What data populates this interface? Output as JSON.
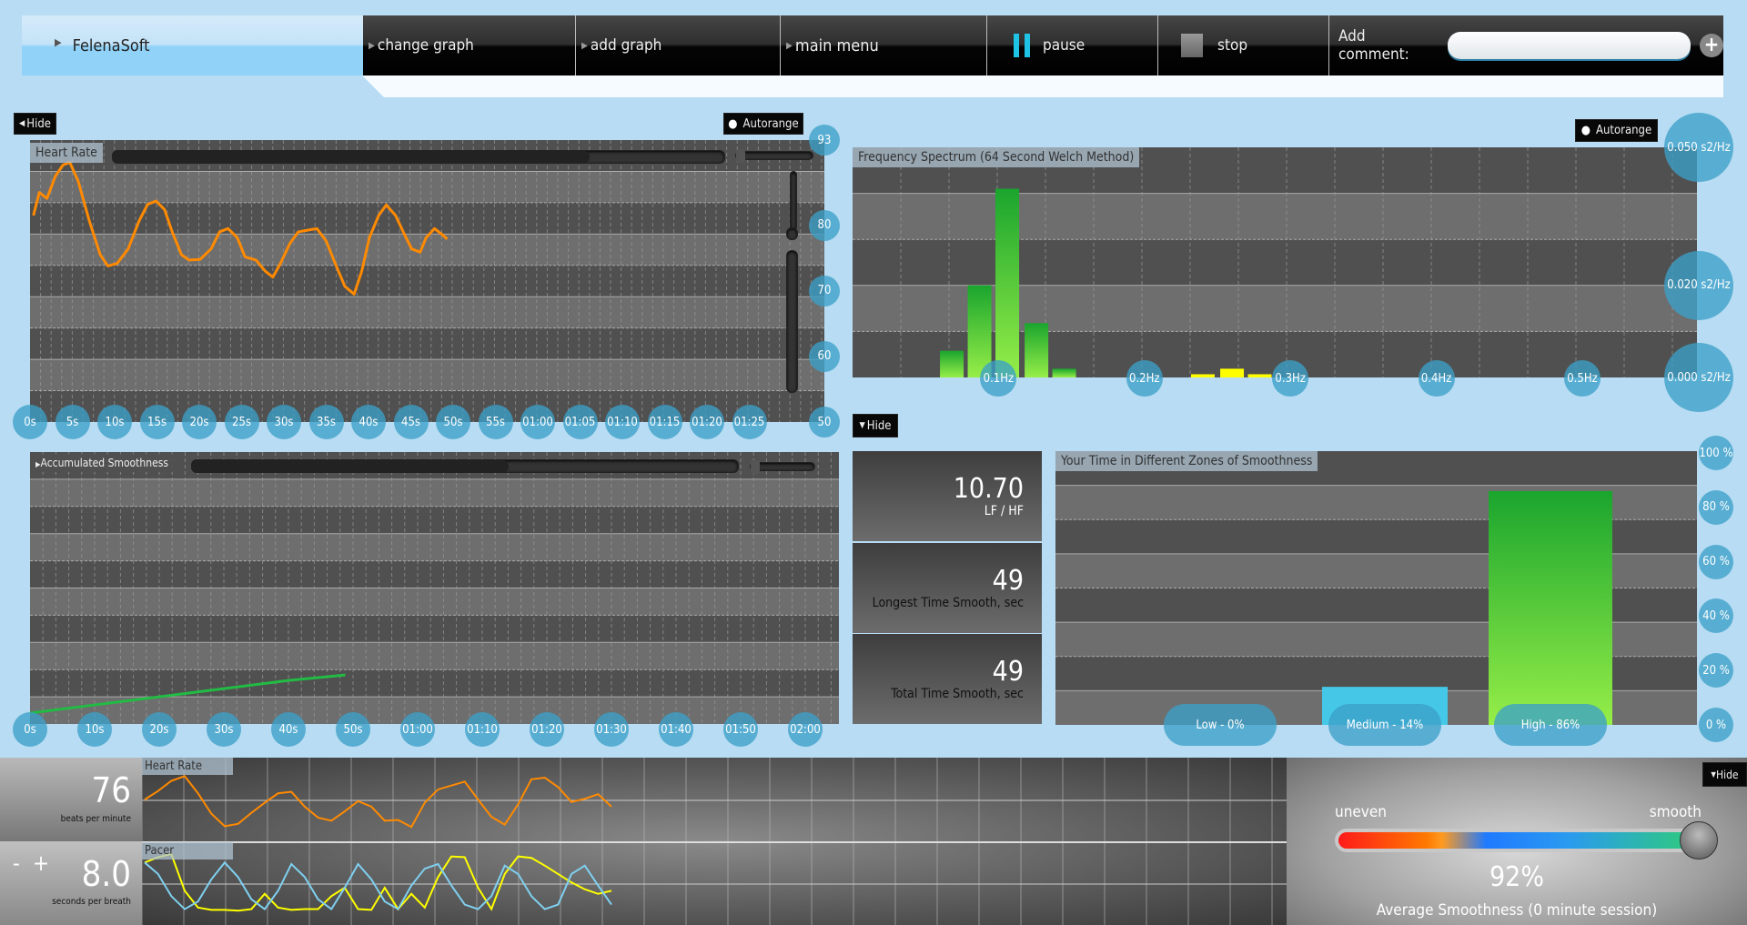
{
  "header": {
    "app_name": "FelenaSoft",
    "buttons": [
      {
        "label": "change graph"
      },
      {
        "label": "add graph"
      },
      {
        "label": "main menu"
      },
      {
        "label": "pause",
        "icon": "pause-icon"
      },
      {
        "label": "stop",
        "icon": "stop-icon"
      }
    ],
    "comment_label": "Add comment:",
    "comment_value": "",
    "add_icon": "plus-icon"
  },
  "controls": {
    "hide": "Hide",
    "autorange": "Autorange"
  },
  "colors": {
    "accent": "#3ca0c8",
    "heart_rate": "#ff8a00",
    "green": "#22aa33",
    "yellow": "#ffff00",
    "medium": "#45c8e8",
    "pacer_blue": "#7fd0f0"
  },
  "chart_data": [
    {
      "type": "line",
      "title": "Heart Rate",
      "ylim": [
        50,
        93
      ],
      "yticks": [
        "93",
        "80",
        "70",
        "60",
        "50"
      ],
      "xlim": [
        0,
        88
      ],
      "xticks": [
        "0s",
        "5s",
        "10s",
        "15s",
        "20s",
        "25s",
        "30s",
        "35s",
        "40s",
        "45s",
        "50s",
        "55s",
        "01:00",
        "01:05",
        "01:10",
        "01:15",
        "01:20",
        "01:25"
      ],
      "series": [
        {
          "color": "#ff8a00",
          "points": [
            [
              0.4,
              81.5
            ],
            [
              1.1,
              85
            ],
            [
              2,
              84.1
            ],
            [
              3,
              87.5
            ],
            [
              3.9,
              89.2
            ],
            [
              4.7,
              89.6
            ],
            [
              5.7,
              86.7
            ],
            [
              7,
              80.7
            ],
            [
              8.3,
              75.5
            ],
            [
              9.2,
              73.8
            ],
            [
              10.3,
              74.2
            ],
            [
              11.6,
              76.4
            ],
            [
              12.9,
              80.7
            ],
            [
              13.9,
              83.2
            ],
            [
              14.9,
              83.7
            ],
            [
              15.9,
              82.4
            ],
            [
              16.8,
              79
            ],
            [
              17.9,
              75.5
            ],
            [
              18.8,
              74.7
            ],
            [
              20.1,
              74.8
            ],
            [
              21.4,
              76.4
            ],
            [
              22.4,
              79
            ],
            [
              23.4,
              79.5
            ],
            [
              24.5,
              78.1
            ],
            [
              25.4,
              75.2
            ],
            [
              26.7,
              74.7
            ],
            [
              27.8,
              73
            ],
            [
              28.7,
              72.1
            ],
            [
              29.6,
              74.2
            ],
            [
              30.7,
              77.2
            ],
            [
              31.7,
              79
            ],
            [
              33,
              79.3
            ],
            [
              33.9,
              79.5
            ],
            [
              35,
              77.6
            ],
            [
              35.9,
              74.7
            ],
            [
              37.2,
              70.7
            ],
            [
              38.3,
              69.5
            ],
            [
              39.2,
              73
            ],
            [
              40.1,
              78.1
            ],
            [
              41.2,
              81.5
            ],
            [
              42.1,
              83.1
            ],
            [
              43.2,
              81.5
            ],
            [
              44.1,
              79
            ],
            [
              45.1,
              76.4
            ],
            [
              46.1,
              75.9
            ],
            [
              46.8,
              78.1
            ],
            [
              47.8,
              79.5
            ],
            [
              48.7,
              78.6
            ],
            [
              49.3,
              77.9
            ]
          ]
        }
      ]
    },
    {
      "type": "bar",
      "title": "Frequency Spectrum (64 Second Welch Method)",
      "ylim": [
        0,
        0.05
      ],
      "yticks": [
        "0.050 s2/Hz",
        "0.020 s2/Hz",
        "0.000 s2/Hz"
      ],
      "xlim": [
        0,
        0.58
      ],
      "xticks": [
        "0.1Hz",
        "0.2Hz",
        "0.3Hz",
        "0.4Hz",
        "0.5Hz"
      ],
      "bars": [
        {
          "x": 0.068,
          "y": 0.0058,
          "color": "green"
        },
        {
          "x": 0.087,
          "y": 0.02,
          "color": "green"
        },
        {
          "x": 0.106,
          "y": 0.041,
          "color": "green"
        },
        {
          "x": 0.126,
          "y": 0.0118,
          "color": "green"
        },
        {
          "x": 0.145,
          "y": 0.0019,
          "color": "green"
        },
        {
          "x": 0.24,
          "y": 0.0007,
          "color": "yellow"
        },
        {
          "x": 0.26,
          "y": 0.0019,
          "color": "yellow"
        },
        {
          "x": 0.279,
          "y": 0.0007,
          "color": "yellow"
        }
      ]
    },
    {
      "type": "line",
      "title": "Accumulated Smoothness",
      "xlim": [
        0,
        126
      ],
      "ylim": [
        0,
        1
      ],
      "xticks": [
        "0s",
        "10s",
        "20s",
        "30s",
        "40s",
        "50s",
        "01:00",
        "01:10",
        "01:20",
        "01:30",
        "01:40",
        "01:50",
        "02:00"
      ],
      "series": [
        {
          "color": "#22bb44",
          "points": [
            [
              0,
              0.04
            ],
            [
              10,
              0.07
            ],
            [
              20,
              0.1
            ],
            [
              30,
              0.13
            ],
            [
              40,
              0.16
            ],
            [
              48.8,
              0.18
            ]
          ]
        }
      ]
    },
    {
      "type": "bar",
      "title": "Your Time in Different Zones of Smoothness",
      "ylim": [
        0,
        100
      ],
      "yticks": [
        "100 %",
        "80 %",
        "60 %",
        "40 %",
        "20 %",
        "0 %"
      ],
      "categories": [
        "Low - 0%",
        "Medium - 14%",
        "High - 86%"
      ],
      "values": [
        0,
        14,
        86
      ]
    },
    {
      "type": "line",
      "title": "Heart Rate",
      "series": [
        {
          "color": "#ff8a00",
          "values": [
            0.51,
            0.62,
            0.75,
            0.81,
            0.59,
            0.33,
            0.17,
            0.2,
            0.34,
            0.47,
            0.59,
            0.61,
            0.42,
            0.28,
            0.24,
            0.36,
            0.49,
            0.42,
            0.24,
            0.25,
            0.16,
            0.47,
            0.64,
            0.69,
            0.74,
            0.51,
            0.29,
            0.19,
            0.45,
            0.77,
            0.79,
            0.67,
            0.48,
            0.52,
            0.58,
            0.42
          ]
        }
      ]
    },
    {
      "type": "line",
      "title": "Pacer",
      "series": [
        {
          "color": "#ffff00",
          "values": [
            0.77,
            0.84,
            0.88,
            0.4,
            0.18,
            0.15,
            0.15,
            0.14,
            0.16,
            0.36,
            0.18,
            0.15,
            0.16,
            0.16,
            0.33,
            0.44,
            0.16,
            0.15,
            0.44,
            0.16,
            0.36,
            0.18,
            0.58,
            0.85,
            0.84,
            0.44,
            0.16,
            0.62,
            0.85,
            0.83,
            0.73,
            0.62,
            0.51,
            0.42,
            0.36,
            0.4
          ]
        },
        {
          "color": "#7fd0f0",
          "values": [
            0.77,
            0.62,
            0.33,
            0.16,
            0.26,
            0.55,
            0.77,
            0.58,
            0.29,
            0.16,
            0.4,
            0.75,
            0.58,
            0.29,
            0.16,
            0.44,
            0.75,
            0.55,
            0.26,
            0.16,
            0.47,
            0.69,
            0.75,
            0.47,
            0.22,
            0.16,
            0.33,
            0.73,
            0.62,
            0.33,
            0.16,
            0.22,
            0.62,
            0.73,
            0.47,
            0.22
          ]
        }
      ]
    }
  ],
  "stats": [
    {
      "value": "10.70",
      "label": "LF / HF"
    },
    {
      "value": "49",
      "label": "Longest Time Smooth, sec"
    },
    {
      "value": "49",
      "label": "Total Time Smooth, sec"
    }
  ],
  "bottom": {
    "heart_rate_value": "76",
    "heart_rate_unit": "beats per minute",
    "pacer_value": "8.0",
    "pacer_unit": "seconds per breath",
    "minus": "-",
    "plus": "+",
    "hr_label": "Heart Rate",
    "pacer_label": "Pacer",
    "uneven": "uneven",
    "smooth": "smooth",
    "smoothness_percent": 92,
    "smoothness_value": "92%",
    "smoothness_caption": "Average Smoothness (0 minute session)"
  }
}
